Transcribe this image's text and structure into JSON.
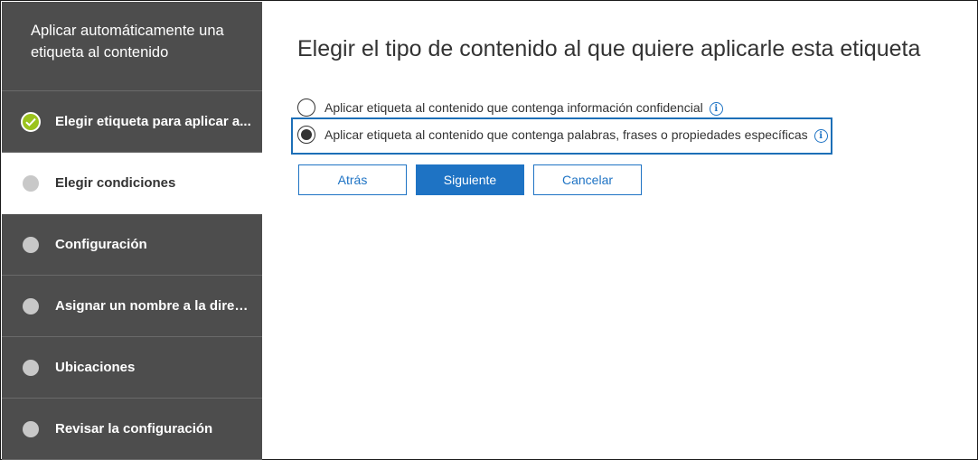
{
  "wizard": {
    "title": "Aplicar automáticamente una etiqueta al contenido",
    "steps": [
      {
        "label": "Elegir etiqueta para aplicar a...",
        "state": "done",
        "icon": "checkmark-icon"
      },
      {
        "label": "Elegir condiciones",
        "state": "current",
        "icon": "step-dot-icon"
      },
      {
        "label": "Configuración",
        "state": "pending",
        "icon": "step-dot-icon"
      },
      {
        "label": "Asignar un nombre a la directiva",
        "state": "pending",
        "icon": "step-dot-icon"
      },
      {
        "label": "Ubicaciones",
        "state": "pending",
        "icon": "step-dot-icon"
      },
      {
        "label": "Revisar la configuración",
        "state": "pending",
        "icon": "step-dot-icon"
      }
    ]
  },
  "main": {
    "title": "Elegir el tipo de contenido al que quiere aplicarle esta etiqueta",
    "options": [
      {
        "label": "Aplicar etiqueta al contenido que contenga información confidencial",
        "selected": false,
        "info_icon": "info-icon"
      },
      {
        "label": "Aplicar etiqueta al contenido que contenga palabras, frases o propiedades específicas",
        "selected": true,
        "info_icon": "info-icon"
      }
    ],
    "buttons": {
      "back": "Atrás",
      "next": "Siguiente",
      "cancel": "Cancelar"
    }
  },
  "colors": {
    "sidebar_bg": "#4d4d4d",
    "accent": "#1e73c4",
    "done": "#9bc31d",
    "pending_dot": "#c8c8c8"
  }
}
